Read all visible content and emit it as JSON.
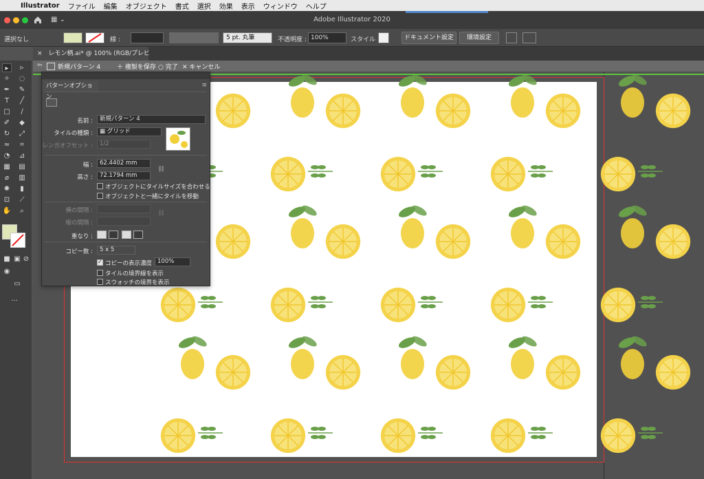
{
  "menubar": {
    "apple": "",
    "app_name": "Illustrator",
    "items": [
      "ファイル",
      "編集",
      "オブジェクト",
      "書式",
      "選択",
      "効果",
      "表示",
      "ウィンドウ",
      "ヘルプ"
    ]
  },
  "titlebar": {
    "app_title": "Adobe Illustrator 2020",
    "workspace_glyph": "▦ ⌄"
  },
  "controlbar": {
    "selection": "選択なし",
    "stroke_label": "線 :",
    "brush": "5 pt. 丸筆",
    "opacity_label": "不透明度 :",
    "opacity_value": "100%",
    "style_label": "スタイル :",
    "document_settings": "ドキュメント設定",
    "preferences": "環境設定"
  },
  "document": {
    "tab_label": "レモン柄.ai* @ 100% (RGB/プレビュー)",
    "close": "×"
  },
  "pattern_bar": {
    "back_icon": "⇦",
    "name": "新規パターン 4",
    "save_copy": "複製を保存",
    "done": "完了",
    "cancel": "キャンセル"
  },
  "panel": {
    "title": "パターンオプション",
    "menu_icon": "≡",
    "name_label": "名前 :",
    "name_value": "新規パターン 4",
    "tile_type_label": "タイルの種類 :",
    "tile_type_value": "グリッド",
    "brick_offset_label": "レンガオフセット :",
    "brick_offset_value": "1/2",
    "width_label": "幅 :",
    "width_value": "62.4402 mm",
    "height_label": "高さ :",
    "height_value": "72.1794 mm",
    "opt_fit_tile": "オブジェクトにタイルサイズを合わせる",
    "opt_move_tile": "オブジェクトと一緒にタイルを移動",
    "h_spacing_label": "横の間隔 :",
    "v_spacing_label": "縦の間隔 :",
    "overlap_label": "重なり :",
    "copies_label": "コピー数 :",
    "copies_value": "5 x 5",
    "dim_copies_label": "コピーの表示濃度 :",
    "dim_copies_value": "100%",
    "show_tile_edge": "タイルの境界線を表示",
    "show_swatch_bounds": "スウォッチの境界を表示"
  },
  "colors": {
    "artboard": "#ffffff",
    "canvas": "#515151",
    "lemon_yellow": "#f2cf3a",
    "leaf_green": "#6aa04a",
    "tile_edge_green": "#5ec63d",
    "artboard_border": "#dd3333"
  }
}
